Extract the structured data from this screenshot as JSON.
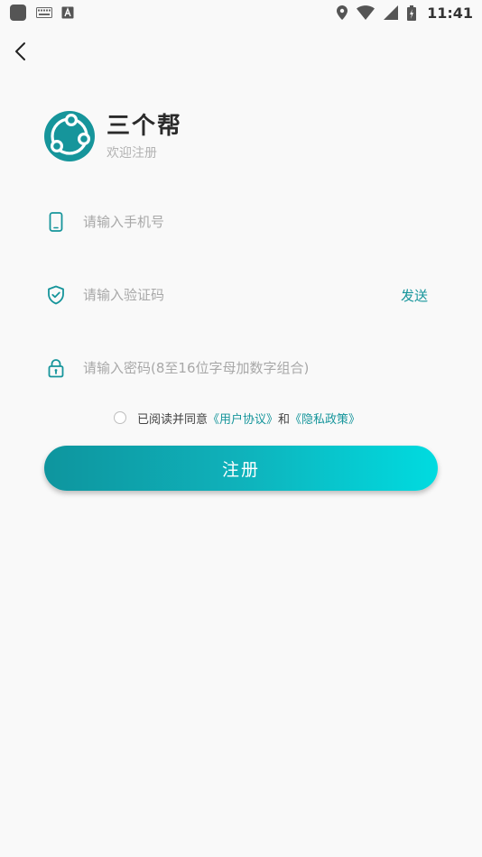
{
  "status_bar": {
    "time": "11:41"
  },
  "app": {
    "name": "三个帮",
    "subtitle": "欢迎注册"
  },
  "form": {
    "phone_placeholder": "请输入手机号",
    "code_placeholder": "请输入验证码",
    "send_label": "发送",
    "password_placeholder": "请输入密码(8至16位字母加数字组合)"
  },
  "agreement": {
    "prefix": "已阅读并同意",
    "user_agreement": "《用户协议》",
    "and": "和",
    "privacy_policy": "《隐私政策》"
  },
  "register_label": "注册",
  "colors": {
    "accent": "#15959b",
    "button_start": "#0e959e",
    "button_end": "#00dbe0"
  },
  "icons": {
    "back": "chevron-left-icon",
    "phone": "phone-icon",
    "code": "shield-check-icon",
    "password": "lock-icon"
  }
}
